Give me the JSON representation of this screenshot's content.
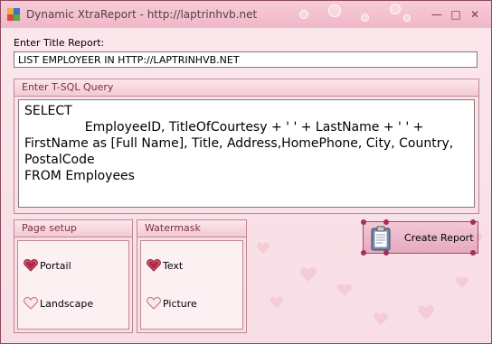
{
  "window": {
    "title": "Dynamic XtraReport - http://laptrinhvb.net"
  },
  "form": {
    "title_label": "Enter Title Report:",
    "title_value": "LIST EMPLOYEER IN HTTP://LAPTRINHVB.NET",
    "sql_group_title": "Enter T-SQL Query",
    "sql_value": "SELECT\n               EmployeeID, TitleOfCourtesy + ' ' + LastName + ' ' +\nFirstName as [Full Name], Title, Address,HomePhone, City, Country,\nPostalCode\nFROM Employees",
    "page_setup": {
      "title": "Page setup",
      "options": [
        {
          "label": "Portail",
          "selected": true
        },
        {
          "label": "Landscape",
          "selected": false
        }
      ]
    },
    "watermark": {
      "title": "Watermask",
      "options": [
        {
          "label": "Text",
          "selected": true
        },
        {
          "label": "Picture",
          "selected": false
        }
      ]
    },
    "create_button": "Create Report"
  },
  "colors": {
    "accent": "#a42e59",
    "border": "#c08890",
    "background": "#fbe3ea"
  }
}
